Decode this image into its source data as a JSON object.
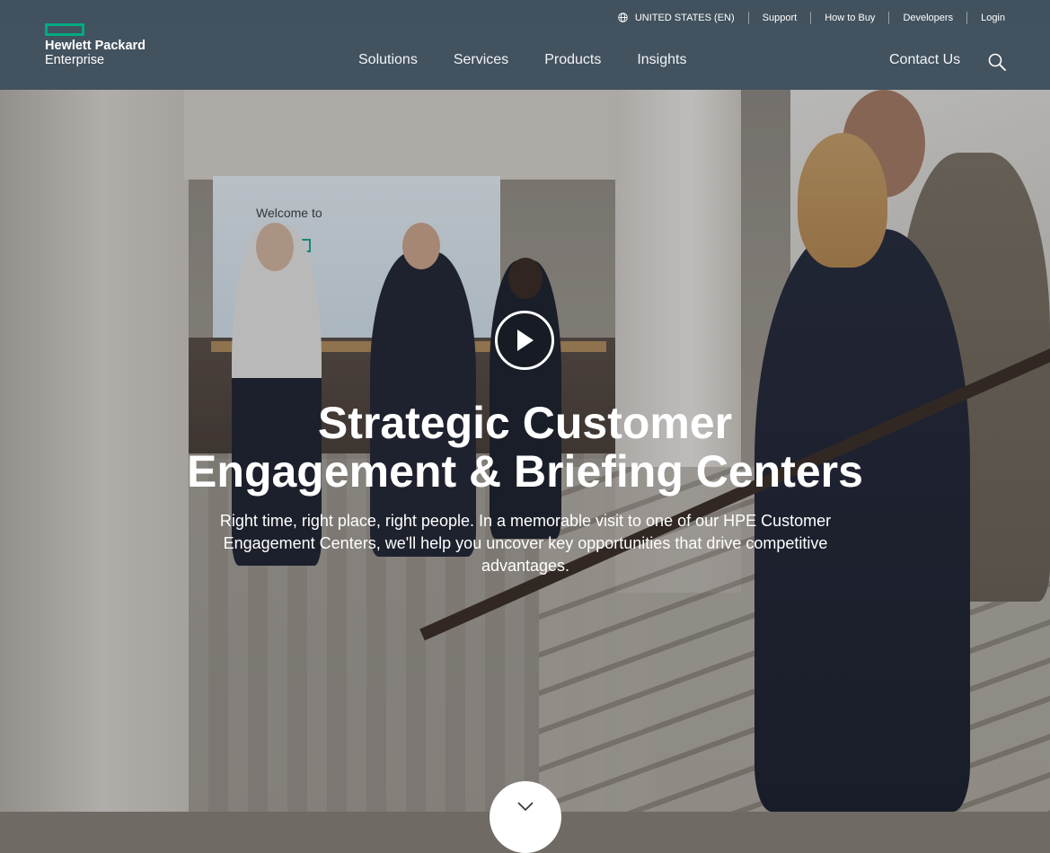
{
  "header": {
    "logo": {
      "line1": "Hewlett Packard",
      "line2": "Enterprise"
    },
    "utility_nav": {
      "region": "UNITED STATES (EN)",
      "support": "Support",
      "how_to_buy": "How to Buy",
      "developers": "Developers",
      "login": "Login"
    },
    "main_nav": [
      {
        "label": "Solutions"
      },
      {
        "label": "Services"
      },
      {
        "label": "Products"
      },
      {
        "label": "Insights"
      }
    ],
    "contact": "Contact Us",
    "icons": {
      "region": "globe-icon",
      "search": "search-icon"
    }
  },
  "hero": {
    "screen_text": {
      "welcome": "Welcome to",
      "brand": "Hewlett Packard Enterprise"
    },
    "title_line1": "Strategic Customer",
    "title_line2": "Engagement & Briefing Centers",
    "description": "Right time, right place, right people. In a memorable visit to one of our HPE Customer Engagement Centers, we'll help you uncover key opportunities that drive competitive advantages.",
    "icons": {
      "play": "play-icon",
      "scroll": "chevron-down-icon"
    }
  },
  "colors": {
    "brand_green": "#01a982",
    "header_bg": "#344a5c",
    "text": "#ffffff"
  }
}
